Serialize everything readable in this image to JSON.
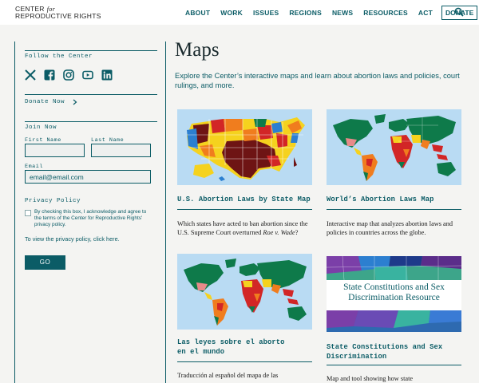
{
  "header": {
    "logo_line1": "CENTER",
    "logo_for": "for",
    "logo_line2": "REPRODUCTIVE RIGHTS",
    "nav": [
      "ABOUT",
      "WORK",
      "ISSUES",
      "REGIONS",
      "NEWS",
      "RESOURCES",
      "ACT"
    ],
    "donate": "DONATE",
    "search_icon": "search-icon"
  },
  "sidebar": {
    "follow_heading": "Follow the Center",
    "social_icons": [
      "x-icon",
      "facebook-icon",
      "instagram-icon",
      "youtube-icon",
      "linkedin-icon"
    ],
    "donate_now": "Donate Now",
    "join_heading": "Join Now",
    "first_name_label": "First Name",
    "last_name_label": "Last Name",
    "email_label": "Email",
    "email_placeholder": "email@email.com",
    "privacy_heading": "Privacy Policy",
    "checkbox_text": "By checking this box, I acknowledge and agree to the terms of the Center for Reproductive Rights' privacy policy.",
    "privacy_line_text": "To view the privacy policy, ",
    "privacy_link": "click here",
    "privacy_line_end": ".",
    "go_button": "GO"
  },
  "main": {
    "title": "Maps",
    "intro": "Explore the Center’s interactive maps and learn about abortion laws and policies, court rulings, and more.",
    "cards": [
      {
        "title": "U.S. Abortion Laws by State Map",
        "desc_pre": "Which states have acted to ban abortion since the U.S. Supreme Court overturned ",
        "desc_italic": "Roe v. Wade",
        "desc_post": "?"
      },
      {
        "title": "World’s Abortion Laws Map",
        "desc": "Interactive map that analyzes abortion laws and policies in countries across the globe."
      },
      {
        "title": "Las leyes sobre el aborto en el mundo",
        "desc": "Traducción al español del mapa de las"
      },
      {
        "title": "State Constitutions and Sex Discrimination",
        "image_caption": "State Constitutions and Sex Discrimination Resource",
        "desc": "Map and tool showing how state"
      }
    ]
  },
  "colors": {
    "brand_teal": "#0b5c66",
    "map_dark_red": "#6e1414",
    "map_red": "#d22626",
    "map_orange": "#f07d1e",
    "map_yellow": "#f5d21e",
    "map_green": "#0e7a4a",
    "map_blue": "#2c7fd0",
    "ocean": "#b9dbf3"
  }
}
